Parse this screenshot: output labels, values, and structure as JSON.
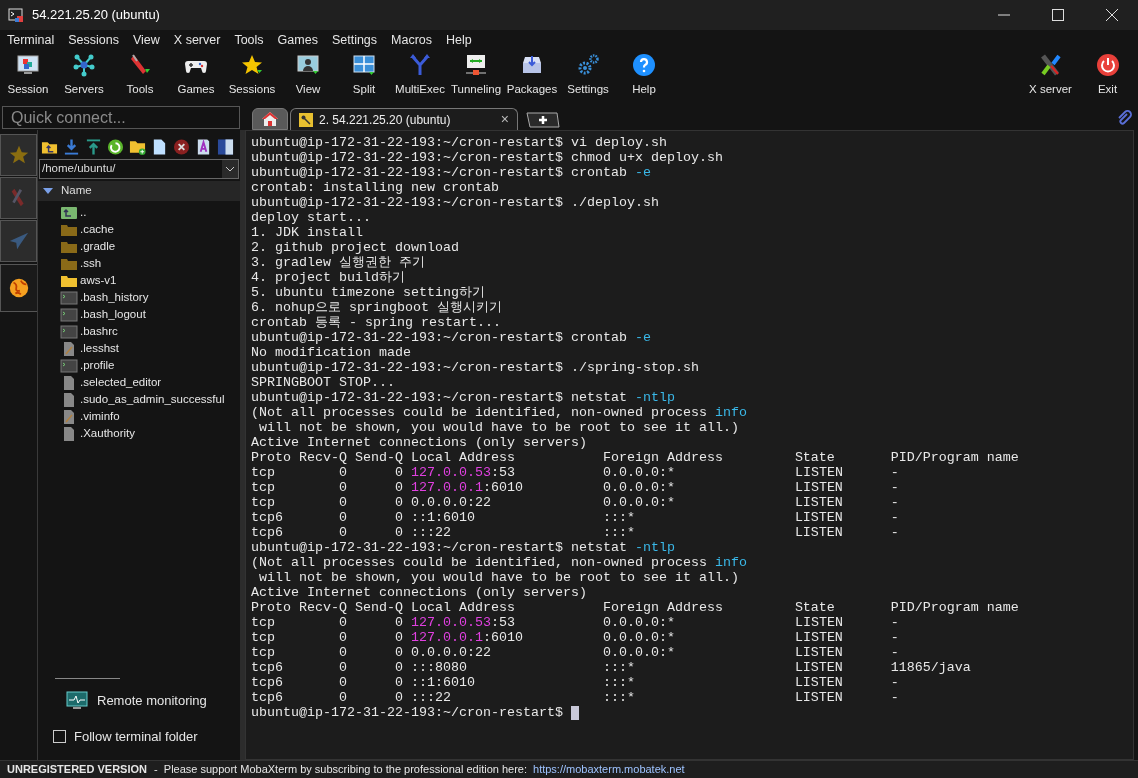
{
  "window": {
    "title": "54.221.25.20 (ubuntu)"
  },
  "menu": [
    "Terminal",
    "Sessions",
    "View",
    "X server",
    "Tools",
    "Games",
    "Settings",
    "Macros",
    "Help"
  ],
  "toolbar": [
    {
      "label": "Session",
      "kind": "session"
    },
    {
      "label": "Servers",
      "kind": "servers"
    },
    {
      "label": "Tools",
      "kind": "tools"
    },
    {
      "label": "Games",
      "kind": "games"
    },
    {
      "label": "Sessions",
      "kind": "sessions"
    },
    {
      "label": "View",
      "kind": "view"
    },
    {
      "label": "Split",
      "kind": "split"
    },
    {
      "label": "MultiExec",
      "kind": "multiexec"
    },
    {
      "label": "Tunneling",
      "kind": "tunneling"
    },
    {
      "label": "Packages",
      "kind": "packages"
    },
    {
      "label": "Settings",
      "kind": "settings"
    },
    {
      "label": "Help",
      "kind": "help"
    }
  ],
  "toolbar_right": [
    {
      "label": "X server",
      "kind": "xserver"
    },
    {
      "label": "Exit",
      "kind": "exit"
    }
  ],
  "quick_connect": {
    "placeholder": "Quick connect..."
  },
  "tabs": [
    {
      "kind": "home",
      "selected": false
    },
    {
      "kind": "session",
      "label": "2. 54.221.25.20 (ubuntu)",
      "close": "×",
      "selected": true
    }
  ],
  "side_tabs": [
    {
      "kind": "star",
      "selected": false
    },
    {
      "kind": "tools",
      "selected": false
    },
    {
      "kind": "send",
      "selected": false
    },
    {
      "kind": "globe",
      "selected": true
    }
  ],
  "file_browser": {
    "path": "/home/ubuntu/",
    "column": "Name",
    "items": [
      {
        "name": "..",
        "kind": "parent"
      },
      {
        "name": ".cache",
        "kind": "hidden-folder"
      },
      {
        "name": ".gradle",
        "kind": "hidden-folder"
      },
      {
        "name": ".ssh",
        "kind": "hidden-folder"
      },
      {
        "name": "aws-v1",
        "kind": "folder"
      },
      {
        "name": ".bash_history",
        "kind": "script"
      },
      {
        "name": ".bash_logout",
        "kind": "script"
      },
      {
        "name": ".bashrc",
        "kind": "script"
      },
      {
        "name": ".lesshst",
        "kind": "edited"
      },
      {
        "name": ".profile",
        "kind": "script"
      },
      {
        "name": ".selected_editor",
        "kind": "file"
      },
      {
        "name": ".sudo_as_admin_successful",
        "kind": "file"
      },
      {
        "name": ".viminfo",
        "kind": "edited"
      },
      {
        "name": ".Xauthority",
        "kind": "file"
      }
    ]
  },
  "remote_monitoring": "Remote monitoring",
  "follow_folder": {
    "label": "Follow terminal folder",
    "checked": false
  },
  "terminal": {
    "lines": [
      [
        {
          "text": "ubuntu@ip-172-31-22-193:~/cron-restart$ vi deploy.sh"
        }
      ],
      [
        {
          "text": "ubuntu@ip-172-31-22-193:~/cron-restart$ chmod u+x deploy.sh"
        }
      ],
      [
        {
          "text": "ubuntu@ip-172-31-22-193:~/cron-restart$ crontab "
        },
        {
          "text": "-e",
          "kind": "option"
        }
      ],
      [
        {
          "text": "crontab: installing new crontab"
        }
      ],
      [
        {
          "text": "ubuntu@ip-172-31-22-193:~/cron-restart$ ./deploy.sh"
        }
      ],
      [
        {
          "text": "deploy start..."
        }
      ],
      [
        {
          "text": "1. JDK install"
        }
      ],
      [
        {
          "text": "2. github project download"
        }
      ],
      [
        {
          "text": "3. gradlew 실행권한 주기"
        }
      ],
      [
        {
          "text": "4. project build하기"
        }
      ],
      [
        {
          "text": "5. ubuntu timezone setting하기"
        }
      ],
      [
        {
          "text": "6. nohup으로 springboot 실행시키기"
        }
      ],
      [
        {
          "text": "crontab 등록 - spring restart..."
        }
      ],
      [
        {
          "text": "ubuntu@ip-172-31-22-193:~/cron-restart$ crontab "
        },
        {
          "text": "-e",
          "kind": "option"
        }
      ],
      [
        {
          "text": "No modification made"
        }
      ],
      [
        {
          "text": "ubuntu@ip-172-31-22-193:~/cron-restart$ ./spring-stop.sh"
        }
      ],
      [
        {
          "text": "SPRINGBOOT STOP..."
        }
      ],
      [
        {
          "text": "ubuntu@ip-172-31-22-193:~/cron-restart$ netstat "
        },
        {
          "text": "-ntlp",
          "kind": "option"
        }
      ],
      [
        {
          "text": "(Not all processes could be identified, non-owned process "
        },
        {
          "text": "info",
          "kind": "option"
        }
      ],
      [
        {
          "text": " will not be shown, you would have to be root to see it all.)"
        }
      ],
      [
        {
          "text": "Active Internet connections (only servers)"
        }
      ],
      [
        {
          "text": "Proto Recv-Q Send-Q Local Address           Foreign Address         State       PID/Program name"
        }
      ],
      [
        {
          "text": "tcp        0      0 "
        },
        {
          "text": "127.0.0.53",
          "kind": "address"
        },
        {
          "text": ":53           0.0.0.0:*               LISTEN      -"
        }
      ],
      [
        {
          "text": "tcp        0      0 "
        },
        {
          "text": "127.0.0.1",
          "kind": "address"
        },
        {
          "text": ":6010          0.0.0.0:*               LISTEN      -"
        }
      ],
      [
        {
          "text": "tcp        0      0 0.0.0.0:22              0.0.0.0:*               LISTEN      -"
        }
      ],
      [
        {
          "text": "tcp6       0      0 ::1:6010                :::*                    LISTEN      -"
        }
      ],
      [
        {
          "text": "tcp6       0      0 :::22                   :::*                    LISTEN      -"
        }
      ],
      [
        {
          "text": "ubuntu@ip-172-31-22-193:~/cron-restart$ netstat "
        },
        {
          "text": "-ntlp",
          "kind": "option"
        }
      ],
      [
        {
          "text": "(Not all processes could be identified, non-owned process "
        },
        {
          "text": "info",
          "kind": "option"
        }
      ],
      [
        {
          "text": " will not be shown, you would have to be root to see it all.)"
        }
      ],
      [
        {
          "text": "Active Internet connections (only servers)"
        }
      ],
      [
        {
          "text": "Proto Recv-Q Send-Q Local Address           Foreign Address         State       PID/Program name"
        }
      ],
      [
        {
          "text": "tcp        0      0 "
        },
        {
          "text": "127.0.0.53",
          "kind": "address"
        },
        {
          "text": ":53           0.0.0.0:*               LISTEN      -"
        }
      ],
      [
        {
          "text": "tcp        0      0 "
        },
        {
          "text": "127.0.0.1",
          "kind": "address"
        },
        {
          "text": ":6010          0.0.0.0:*               LISTEN      -"
        }
      ],
      [
        {
          "text": "tcp        0      0 0.0.0.0:22              0.0.0.0:*               LISTEN      -"
        }
      ],
      [
        {
          "text": "tcp6       0      0 :::8080                 :::*                    LISTEN      11865/java"
        }
      ],
      [
        {
          "text": "tcp6       0      0 ::1:6010                :::*                    LISTEN      -"
        }
      ],
      [
        {
          "text": "tcp6       0      0 :::22                   :::*                    LISTEN      -"
        }
      ],
      [
        {
          "text": "ubuntu@ip-172-31-22-193:~/cron-restart$ "
        }
      ]
    ]
  },
  "status_bar": {
    "badge": "UNREGISTERED VERSION",
    "message": " -  Please support MobaXterm by subscribing to the professional edition here:",
    "link": "https://mobaxterm.mobatek.net"
  }
}
